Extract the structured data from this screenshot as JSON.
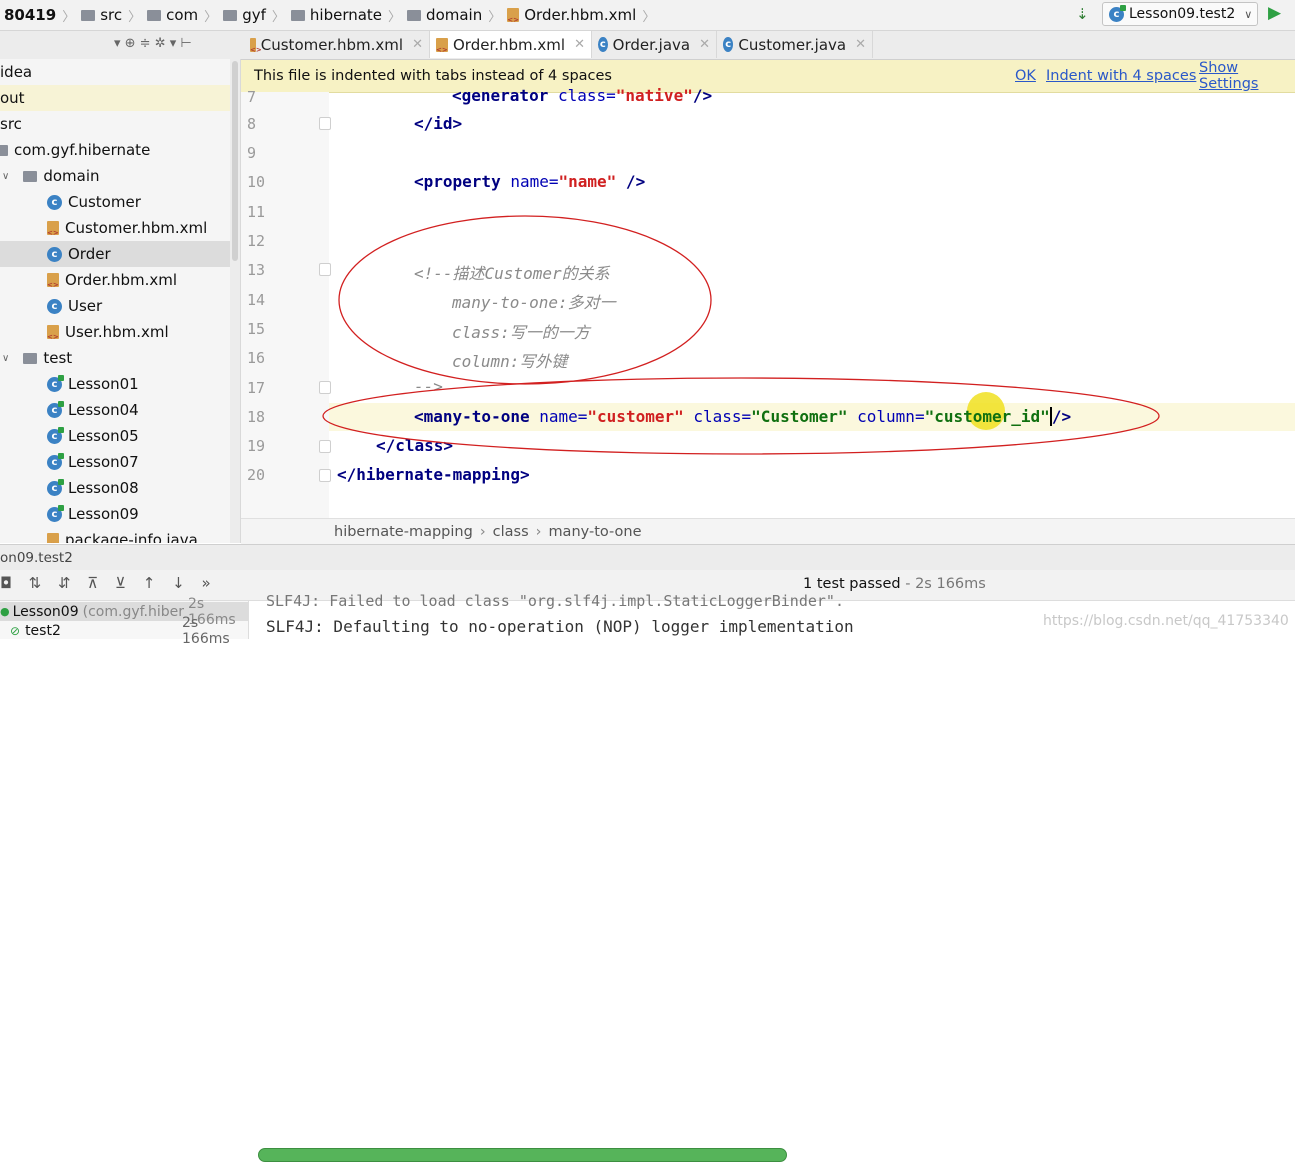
{
  "breadcrumbs": [
    "80419",
    "src",
    "com",
    "gyf",
    "hibernate",
    "domain",
    "Order.hbm.xml"
  ],
  "run_config": {
    "label": "Lesson09.test2"
  },
  "editor_tabs": [
    {
      "label": "Customer.hbm.xml",
      "icon": "xml-file-icon",
      "active": false
    },
    {
      "label": "Order.hbm.xml",
      "icon": "xml-file-icon",
      "active": true
    },
    {
      "label": "Order.java",
      "icon": "class-icon",
      "active": false
    },
    {
      "label": "Customer.java",
      "icon": "class-icon",
      "active": false
    }
  ],
  "project_tree": [
    {
      "label": "idea",
      "icon": "",
      "selected": false
    },
    {
      "label": "out",
      "icon": "",
      "selected": false,
      "highlight": true
    },
    {
      "label": "src",
      "icon": "",
      "selected": false
    },
    {
      "label": "com.gyf.hibernate",
      "icon": "folder",
      "selected": false
    },
    {
      "label": "domain",
      "icon": "folder",
      "selected": false,
      "expanded": true
    },
    {
      "label": "Customer",
      "icon": "class",
      "selected": false
    },
    {
      "label": "Customer.hbm.xml",
      "icon": "xml",
      "selected": false
    },
    {
      "label": "Order",
      "icon": "class",
      "selected": true
    },
    {
      "label": "Order.hbm.xml",
      "icon": "xml",
      "selected": false
    },
    {
      "label": "User",
      "icon": "class",
      "selected": false
    },
    {
      "label": "User.hbm.xml",
      "icon": "xml",
      "selected": false
    },
    {
      "label": "test",
      "icon": "folder",
      "selected": false,
      "expanded": true
    },
    {
      "label": "Lesson01",
      "icon": "test-class",
      "selected": false
    },
    {
      "label": "Lesson04",
      "icon": "test-class",
      "selected": false
    },
    {
      "label": "Lesson05",
      "icon": "test-class",
      "selected": false
    },
    {
      "label": "Lesson07",
      "icon": "test-class",
      "selected": false
    },
    {
      "label": "Lesson08",
      "icon": "test-class",
      "selected": false
    },
    {
      "label": "Lesson09",
      "icon": "test-class",
      "selected": false
    },
    {
      "label": "package-info.java",
      "icon": "xml",
      "selected": false
    }
  ],
  "banner": {
    "message": "This file is indented with tabs instead of 4 spaces",
    "ok": "OK",
    "indent": "Indent with 4 spaces",
    "settings": "Show Settings"
  },
  "code_lines": [
    {
      "n": "7",
      "text": "<generator class=\"native\"/>"
    },
    {
      "n": "8",
      "text": "</id>"
    },
    {
      "n": "9",
      "text": ""
    },
    {
      "n": "10",
      "text": "<property name=\"name\" />"
    },
    {
      "n": "11",
      "text": ""
    },
    {
      "n": "12",
      "text": ""
    },
    {
      "n": "13",
      "text": "<!--描述Customer的关系"
    },
    {
      "n": "14",
      "text": "many-to-one:多对一"
    },
    {
      "n": "15",
      "text": "class:写一的一方"
    },
    {
      "n": "16",
      "text": "column:写外键"
    },
    {
      "n": "17",
      "text": "-->"
    },
    {
      "n": "18",
      "text": "<many-to-one name=\"customer\" class=\"Customer\" column=\"customer_id\"/>"
    },
    {
      "n": "19",
      "text": "</class>"
    },
    {
      "n": "20",
      "text": "</hibernate-mapping>"
    }
  ],
  "editor_breadcrumb": [
    "hibernate-mapping",
    "class",
    "many-to-one"
  ],
  "run_panel": {
    "title": "on09.test2",
    "status": "1 test passed",
    "time": "- 2s 166ms",
    "progress": 1.0,
    "tree": [
      {
        "label": "Lesson09",
        "detail": "(com.gyf.hiber",
        "time": "2s 166ms"
      },
      {
        "label": "test2",
        "time": "2s 166ms"
      }
    ],
    "console_partial": "SLF4J: Failed to load class \"org.slf4j.impl.StaticLoggerBinder\".",
    "console_line": "SLF4J: Defaulting to no-operation (NOP) logger implementation"
  },
  "watermark": "https://blog.csdn.net/qq_41753340",
  "colors": {
    "accent": "#2a58c9",
    "annotation": "#d22020",
    "cursor_highlight": "#f0e020",
    "pass": "#56b45a"
  }
}
